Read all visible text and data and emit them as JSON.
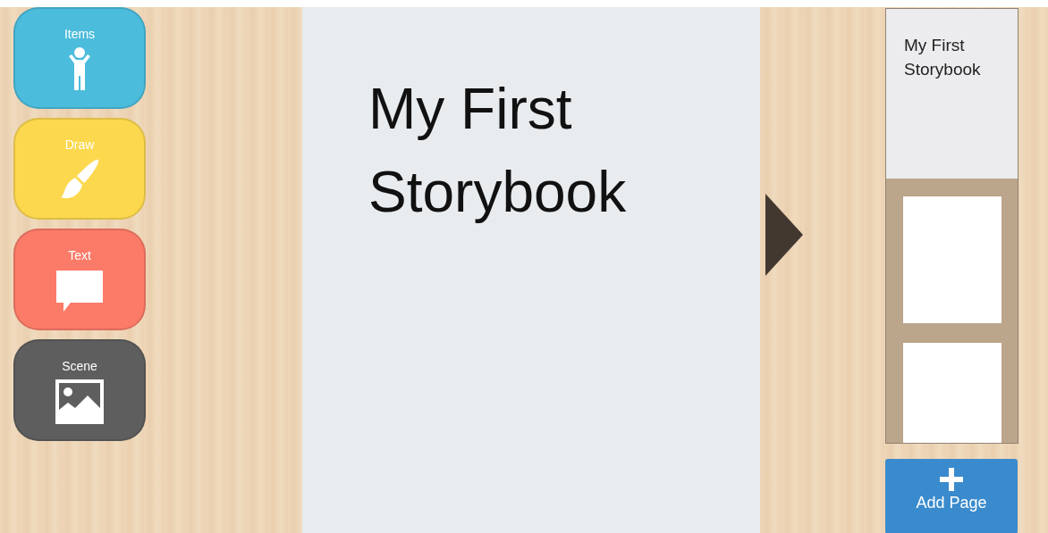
{
  "tools": [
    {
      "label": "Items",
      "kind": "items",
      "color": "#4bbcdc"
    },
    {
      "label": "Draw",
      "kind": "draw",
      "color": "#fcd84e"
    },
    {
      "label": "Text",
      "kind": "text",
      "color": "#fb7b68"
    },
    {
      "label": "Scene",
      "kind": "scene",
      "color": "#5e5e5e"
    }
  ],
  "page": {
    "title": "My First Storybook"
  },
  "pages": [
    {
      "title": "My First Storybook",
      "selected": true
    },
    {
      "selected": false
    },
    {
      "selected": false
    }
  ],
  "add_button": {
    "label": "Add Page"
  }
}
